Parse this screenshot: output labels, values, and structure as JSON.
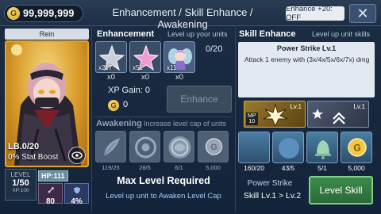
{
  "topbar": {
    "gold": "99,999,999",
    "coin_symbol": "G",
    "title": "Enhancement / Skill Enhance / Awakening",
    "enhance20": "Enhance +20: OFF",
    "close": "✕"
  },
  "unit": {
    "name": "Rein",
    "limit_break": "LB.0/20",
    "stat_boost": "0% Stat Boost",
    "level_label": "LEVEL",
    "level": "1/50",
    "xp": "XP:100",
    "hp": "HP:111",
    "atk": "80",
    "def": "4%"
  },
  "enhancement": {
    "title": "Enhancement",
    "subtitle": "Level up your units",
    "progress": "0/20",
    "slots": [
      {
        "count": "x217",
        "selected": "x0",
        "icon": "silver-star-icon"
      },
      {
        "count": "x51",
        "selected": "x0",
        "icon": "pink-star-icon"
      },
      {
        "count": "x11",
        "selected": "x0",
        "icon": "fairy-unit-icon"
      }
    ],
    "xp_gain": "XP Gain: 0",
    "cost": "0",
    "button": "Enhance"
  },
  "awakening": {
    "title": "Awakening",
    "subtitle": "Increase level cap of units",
    "slots": [
      {
        "value": "119/25",
        "icon": "feather-icon"
      },
      {
        "value": "28/5",
        "icon": "orb-icon"
      },
      {
        "value": "6/1",
        "icon": "sphere-icon"
      },
      {
        "value": "5,000",
        "icon": "gold-coin-icon"
      }
    ],
    "status": "Max Level Required",
    "hint": "Level up unit to Awaken Level Cap"
  },
  "skill": {
    "title": "Skill Enhance",
    "subtitle": "Level up unit skills",
    "name": "Power Strike Lv.1",
    "description": "Attack 1 enemy with (3x/4x/5x/6x/7x) dmg",
    "main_level": "Lv.1",
    "mp_label": "MP",
    "mp_value": "10",
    "secondary_level": "Lv.1",
    "materials": [
      {
        "value": "160/20",
        "icon": "crescent-moon-icon"
      },
      {
        "value": "43/5",
        "icon": "crescent-moon-orb-icon"
      },
      {
        "value": "5/1",
        "icon": "bell-icon"
      },
      {
        "value": "5,000",
        "icon": "gold-coin-icon"
      }
    ],
    "skill_label": "Power Strike",
    "change": "Skill Lv.1 > Lv.2",
    "button": "Level Skill"
  },
  "colors": {
    "background": "#13233a",
    "accent_gold": "#e0a530",
    "button_green": "#3d8a4a"
  }
}
